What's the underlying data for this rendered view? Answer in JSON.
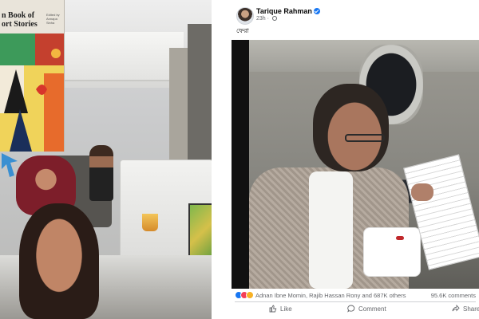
{
  "left_photo": {
    "book": {
      "title": "n Book of\nort Stories",
      "editor_label": "Edited by\nAnnapa Sinha"
    }
  },
  "post": {
    "author": "Tarique Rahman",
    "time": "23h",
    "caption": "ফেরা",
    "reactions_text": "Adnan Ibne Momin, Rajib Hassan Rony and 687K others",
    "comments_count": "95.6K comments",
    "actions": {
      "like": "Like",
      "comment": "Comment",
      "share": "Share"
    },
    "colors": {
      "verified": "#1877f2",
      "like": "#1877f2",
      "love": "#f33e58",
      "care": "#f7b125",
      "secondary_text": "#65676b"
    }
  }
}
